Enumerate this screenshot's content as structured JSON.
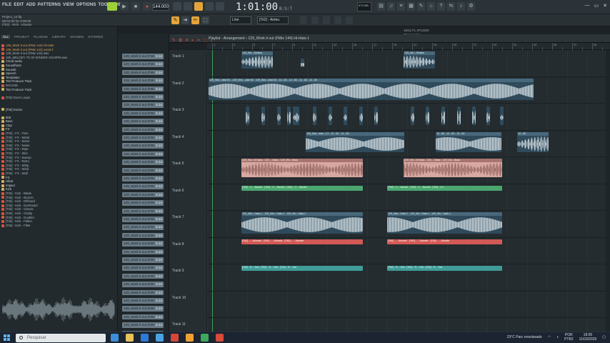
{
  "menu": [
    "FILE",
    "EDIT",
    "ADD",
    "PATTERNS",
    "VIEW",
    "OPTIONS",
    "TOOLS",
    "HELP"
  ],
  "toolbar": {
    "tempo": "144.000",
    "song_time": "1:01:00",
    "song_time_sub": "B:S:T",
    "cpu_info": "573 MB",
    "hint_line1": "16/11 FL STUDIO",
    "hint_line2": "Transporter",
    "pattern_selector": "[Tit2] - Anteu",
    "snap_label": "Line"
  },
  "project": {
    "name": "Project_15.flp",
    "time": "00:01:00 for 0:00:00",
    "selected_item": "(Tit2) - Kick - Alcesto"
  },
  "browser": {
    "tabs": [
      "ALL",
      "PROJECT",
      "PLUGINS",
      "LIBRARY",
      "SOUNDS",
      "STARRED"
    ],
    "items": [
      {
        "text": "129_Work it out (FMix 144) Hi-Hats",
        "cls": "hl"
      },
      {
        "text": "129_Work it out (FMix 144) vocal 2",
        "cls": "hl"
      },
      {
        "text": "128_Work it out (FMix 144) wav",
        "cls": ""
      },
      {
        "text": "195_MELODY TO DI WINDER 194 BPM.wav",
        "cls": ""
      },
      {
        "text": "Cloud audio",
        "cls": "folder"
      },
      {
        "text": "Soundfonts",
        "cls": "folder"
      },
      {
        "text": "Sounds",
        "cls": "folder"
      },
      {
        "text": "Speech",
        "cls": "folder"
      },
      {
        "text": "Templates",
        "cls": "folder"
      },
      {
        "text": "Tit2 Producer Pack",
        "cls": "folder"
      },
      {
        "text": "MACGIE",
        "cls": ""
      },
      {
        "text": "Tit2 Producer Pack",
        "cls": "folder"
      },
      {
        "text": "",
        "cls": ""
      },
      {
        "text": "[Tit2] Drum Loops",
        "cls": ""
      },
      {
        "text": "",
        "cls": ""
      },
      {
        "text": "",
        "cls": ""
      },
      {
        "text": "[Tit2] Drums",
        "cls": "folder"
      },
      {
        "text": "",
        "cls": ""
      },
      {
        "text": "808",
        "cls": "folder"
      },
      {
        "text": "Bass",
        "cls": "folder"
      },
      {
        "text": "Clap",
        "cls": "folder"
      },
      {
        "text": "FX",
        "cls": "folder"
      },
      {
        "text": "[Tit2] - FX - Tone",
        "cls": ""
      },
      {
        "text": "[Tit2] - FX - Metal",
        "cls": ""
      },
      {
        "text": "[Tit2] - FX - Motor",
        "cls": ""
      },
      {
        "text": "[Tit2] - FX - Noise",
        "cls": ""
      },
      {
        "text": "[Tit2] - FX - Rate",
        "cls": ""
      },
      {
        "text": "[Tit2] - FX - Slim",
        "cls": ""
      },
      {
        "text": "[Tit2] - FX - Sweep",
        "cls": ""
      },
      {
        "text": "[Tit2] - FX - Retro",
        "cls": ""
      },
      {
        "text": "[Tit2] - FX - Whip",
        "cls": ""
      },
      {
        "text": "[Tit2] - FX - Wind",
        "cls": ""
      },
      {
        "text": "[Tit2] - FX - Wall",
        "cls": ""
      },
      {
        "text": "FX",
        "cls": "folder"
      },
      {
        "text": "Hihat",
        "cls": "folder"
      },
      {
        "text": "Impact",
        "cls": "folder"
      },
      {
        "text": "Kick",
        "cls": "folder"
      },
      {
        "text": "[Tit2] - Kick - Blade",
        "cls": ""
      },
      {
        "text": "[Tit2] - Kick - Bronze",
        "cls": ""
      },
      {
        "text": "[Tit2] - Kick - Diffused",
        "cls": ""
      },
      {
        "text": "[Tit2] - Kick - Dominator",
        "cls": ""
      },
      {
        "text": "[Tit2] - Kick - Classic",
        "cls": ""
      },
      {
        "text": "[Tit2] - Kick - Clarity",
        "cls": ""
      },
      {
        "text": "[Tit2] - Kick - Doubler",
        "cls": ""
      },
      {
        "text": "[Tit2] - Kick - Fallen",
        "cls": ""
      },
      {
        "text": "[Tit2] - Kick - Filter",
        "cls": ""
      }
    ]
  },
  "playlist": {
    "title": "Playlist - Arrangement › 129_Work it out (FMix 144) Hi-Hats-1",
    "ruler": [
      "1",
      "",
      "3",
      "",
      "5",
      "",
      "7",
      "",
      "9",
      "",
      "11",
      "",
      "13",
      "",
      "15",
      "",
      "17",
      "",
      "19",
      "",
      "21",
      "",
      "23",
      "",
      "25",
      "",
      "27",
      "",
      "29",
      "",
      "31",
      "",
      "33",
      "",
      "35",
      "",
      "37",
      "",
      "39",
      "",
      "41"
    ],
    "tracks": [
      "Track 1",
      "Track 2",
      "Track 3",
      "Track 4",
      "Track 5",
      "Track 6",
      "Track 7",
      "Track 8",
      "Track 9",
      "Track 10",
      "Track 11"
    ]
  },
  "channels": [
    "129_Work it out (FMi",
    "129_Work it out (FMi",
    "129_Work it out (FMi",
    "129_Work it out (FMi",
    "129_Work it out (FMi",
    "129_Work it out (FMi",
    "129_Work it out (FMi",
    "129_Work it out (FMi",
    "129_Work it out (FMi",
    "129_Work it out (FMi",
    "129_Work it out (FMi",
    "129_Work it out (FMi",
    "129_Work it out (FMi",
    "129_Work it out (FMi",
    "129_Work it out (FMi",
    "129_Work it out (FMi",
    "129_Work it out (FMi",
    "129_Work it out (FMi",
    "129_Work it out (FMi",
    "129_Work it out (FMi",
    "129_Work it out (FMi",
    "129_Work it out (FMi",
    "129_Work it out (FMi",
    "129_Work it out (FMi",
    "129_Work it out (FMi",
    "129_Work it out (FMi",
    "129_Work it out (FMi",
    "129_Work it out (FMi",
    "129_Work it out (FMi",
    "129_Work it out (FMi",
    "129_Work it out (FMi",
    "129_Work it out (FMi",
    "129_Work it out (FMi",
    "129_Work it out (FMi",
    "129_Work it out (FMi"
  ],
  "channel_gain": "3.14",
  "clips": {
    "t1": [
      "129_Wo...Section",
      "129_Wo...Section"
    ],
    "t2": "129_Wor...uitar 81 - 129_Wor...uitar 82 - 129_Wor...uitar 83 - 12...83 - 12...83 - 12...83 - 12...83",
    "t4": [
      "129_Wor...ests -1 2 - 12...83 - 12...83",
      "12...83 - 12...83 - 12...83",
      "12...83"
    ],
    "t5": [
      "129_Wo...t4 Bass - 129_...Bass - 129_Wo...Bass",
      "129_Wo...t4 Bass - 129_...Bass - 129_Wo...Bass"
    ],
    "t6": [
      "[Tit2] - C... Bardbl - [Tit2] - C... Bardbl - [Tit2] - C... Bardbl",
      "[Tit2] - C... Bardbl - [Tit2] - C... Bardbl - [Tit2] - Cl..."
    ],
    "t7": [
      "129_Wor...Hats-1 - 129_Wor...Hats-1 - 129_Wo...Hats-1",
      "129_Wor...Hats-1 - 129_Wo...Hats-1 - 129_Wo...Hats-1"
    ],
    "t8": [
      "[Tit2] - ... Alceste - [Tit2] - ... Alceste - [Tit2] - ... Alceste",
      "[Tit2] - ... Alceste - [Tit2] - ... Alceste - [Tit2] - ... Alceste"
    ],
    "t9": [
      "[Tit2] - R... Hat - [Tit2] - R... Hat - [Tit2] - R... Hat",
      "[Tit2] - R... Hat - [Tit2] - R... Hat - [Tit2] - R... Hat"
    ]
  },
  "taskbar": {
    "search_placeholder": "Pesquisar",
    "weather": "23°C  Parc ensolarado",
    "lang1": "POR",
    "lang2": "PTB2",
    "time": "18:05",
    "date": "11/03/2025",
    "icon_colors": [
      "#3c8fd8",
      "#e8c35a",
      "#2e7bd6",
      "#4aa3e0",
      "#d8463a",
      "#f0a030",
      "#3ea85c",
      "#d84a3a"
    ]
  },
  "colors": {
    "accent": "#e5a43a",
    "playhead": "#4bd16d",
    "audio_clip": "#48697b",
    "bass_clip": "#d7a8a1",
    "green_clip": "#4aa56e",
    "red_clip": "#d25a54",
    "teal_clip": "#3f9c97"
  }
}
